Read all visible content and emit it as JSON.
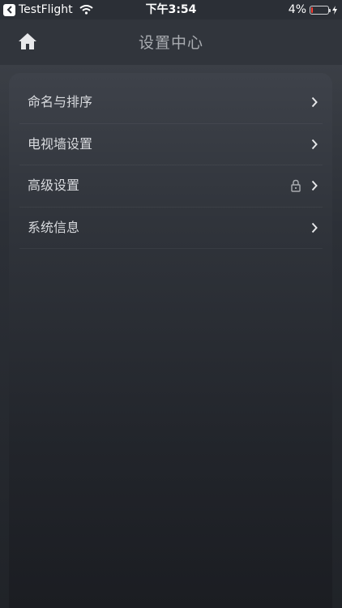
{
  "status_bar": {
    "back_app": "TestFlight",
    "time": "下午3:54",
    "battery_percent": "4%",
    "battery_level": 0.04,
    "battery_color": "#ff3b30"
  },
  "nav": {
    "title": "设置中心",
    "home_icon": "home-icon"
  },
  "settings": {
    "items": [
      {
        "label": "命名与排序",
        "locked": false
      },
      {
        "label": "电视墙设置",
        "locked": false
      },
      {
        "label": "高级设置",
        "locked": true
      },
      {
        "label": "系统信息",
        "locked": false
      }
    ]
  }
}
